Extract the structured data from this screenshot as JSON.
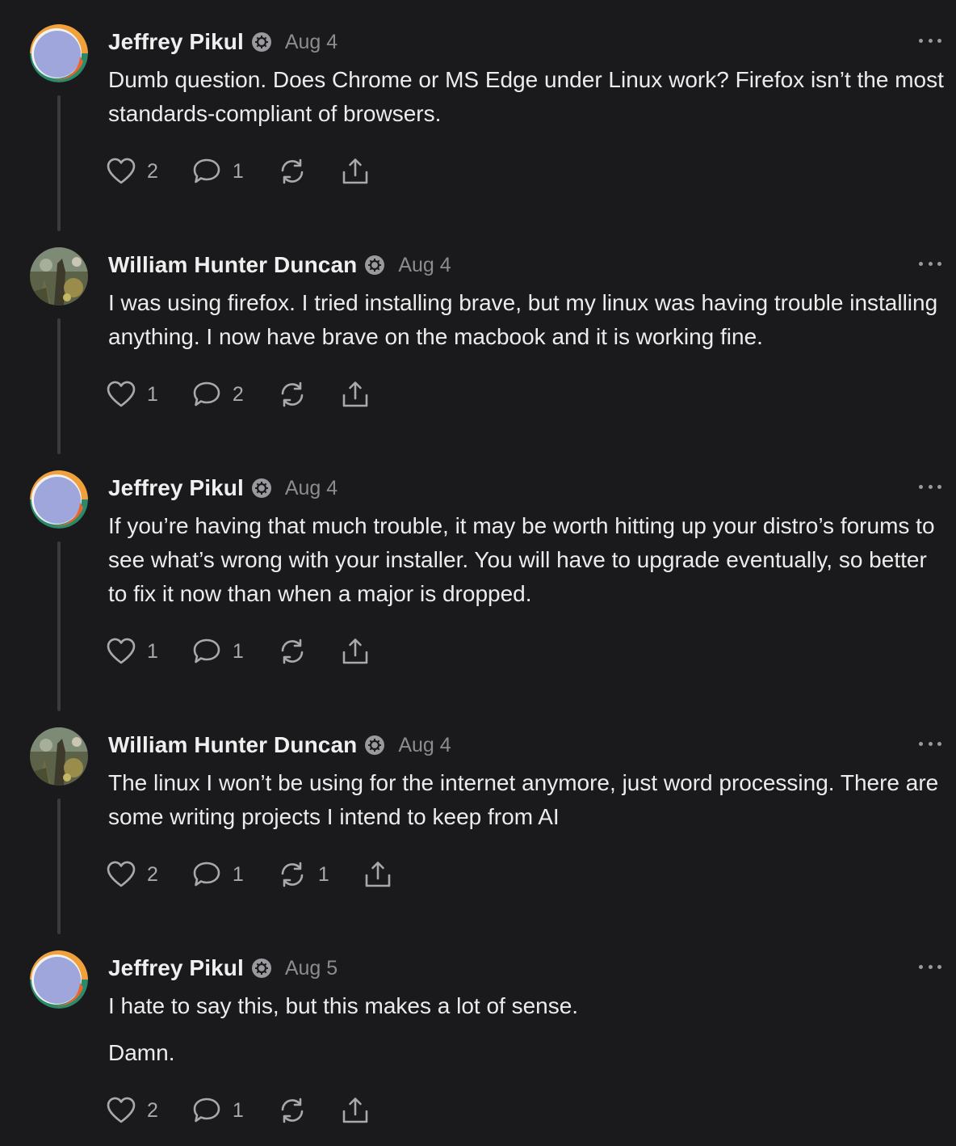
{
  "colors": {
    "background": "#1a1a1c",
    "text": "#ececec",
    "muted": "#8c8c90",
    "thread_line": "#3b3b3d"
  },
  "comments": [
    {
      "author": "Jeffrey Pikul",
      "date": "Aug 4",
      "avatar": "jeffrey-avatar",
      "paragraphs": [
        "Dumb question. Does Chrome or MS Edge under Linux work? Firefox isn’t the most standards-compliant of browsers."
      ],
      "likes": "2",
      "replies": "1",
      "restacks": ""
    },
    {
      "author": "William Hunter Duncan",
      "date": "Aug 4",
      "avatar": "william-avatar",
      "paragraphs": [
        "I was using firefox. I tried installing brave, but my linux was having trouble installing anything. I now have brave on the macbook and it is working fine."
      ],
      "likes": "1",
      "replies": "2",
      "restacks": ""
    },
    {
      "author": "Jeffrey Pikul",
      "date": "Aug 4",
      "avatar": "jeffrey-avatar",
      "paragraphs": [
        "If you’re having that much trouble, it may be worth hitting up your distro’s forums to see what’s wrong with your installer. You will have to upgrade eventually, so better to fix it now than when a major is dropped."
      ],
      "likes": "1",
      "replies": "1",
      "restacks": ""
    },
    {
      "author": "William Hunter Duncan",
      "date": "Aug 4",
      "avatar": "william-avatar",
      "paragraphs": [
        "The linux I won’t be using for the internet anymore, just word processing. There are some writing projects I intend to keep from AI"
      ],
      "likes": "2",
      "replies": "1",
      "restacks": "1"
    },
    {
      "author": "Jeffrey Pikul",
      "date": "Aug 5",
      "avatar": "jeffrey-avatar",
      "paragraphs": [
        "I hate to say this, but this makes a lot of sense.",
        "Damn."
      ],
      "likes": "2",
      "replies": "1",
      "restacks": ""
    }
  ]
}
